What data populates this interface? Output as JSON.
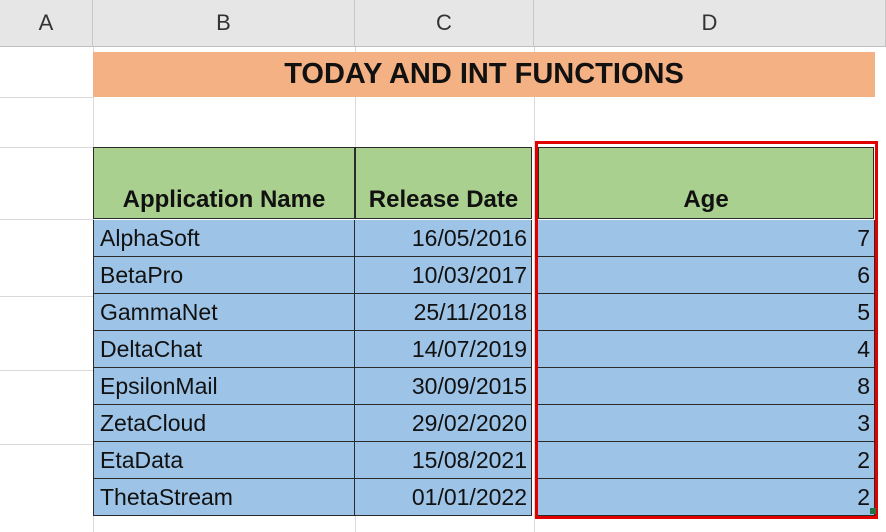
{
  "columns": [
    "A",
    "B",
    "C",
    "D"
  ],
  "title": "TODAY AND INT FUNCTIONS",
  "headers": {
    "app_name": "Application Name",
    "release_date": "Release Date",
    "age": "Age"
  },
  "rows": [
    {
      "name": "AlphaSoft",
      "date": "16/05/2016",
      "age": "7"
    },
    {
      "name": "BetaPro",
      "date": "10/03/2017",
      "age": "6"
    },
    {
      "name": "GammaNet",
      "date": "25/11/2018",
      "age": "5"
    },
    {
      "name": "DeltaChat",
      "date": "14/07/2019",
      "age": "4"
    },
    {
      "name": "EpsilonMail",
      "date": "30/09/2015",
      "age": "8"
    },
    {
      "name": "ZetaCloud",
      "date": "29/02/2020",
      "age": "3"
    },
    {
      "name": "EtaData",
      "date": "15/08/2021",
      "age": "2"
    },
    {
      "name": "ThetaStream",
      "date": "01/01/2022",
      "age": "2"
    }
  ],
  "colors": {
    "title_bg": "#f4b183",
    "header_bg": "#a9d08e",
    "data_bg": "#9dc3e6",
    "highlight": "#e00000"
  }
}
